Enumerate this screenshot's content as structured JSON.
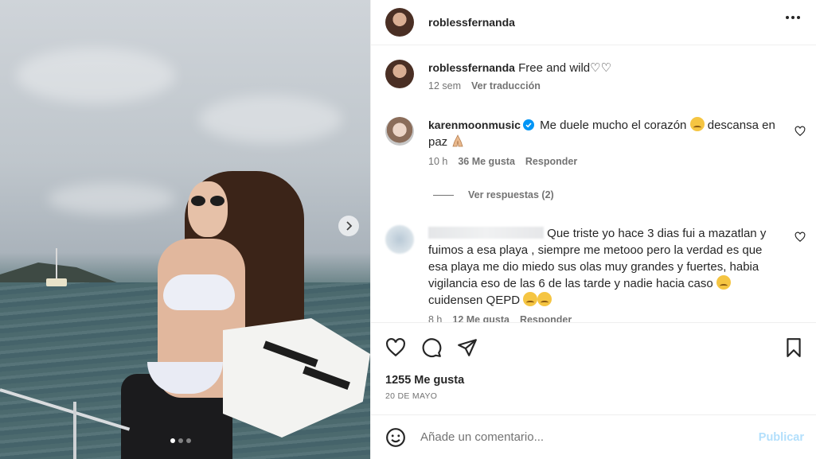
{
  "post": {
    "username": "roblessfernanda",
    "caption": "Free and wild♡♡",
    "caption_time": "12 sem",
    "translate_label": "Ver traducción",
    "likes": "1255 Me gusta",
    "date": "20 DE MAYO",
    "carousel": {
      "total": 3,
      "active": 1
    }
  },
  "comments": [
    {
      "username": "karenmoonmusic",
      "verified": true,
      "text_a": "Me duele mucho el corazón",
      "text_b": "descansa en paz",
      "time": "10 h",
      "likes": "36 Me gusta",
      "reply_label": "Responder",
      "view_replies": "Ver respuestas (2)"
    },
    {
      "username": "",
      "text_a": "Que triste yo hace 3 dias fui a mazatlan y fuimos a esa playa , siempre me metooo pero la verdad es que esa playa me dio miedo sus olas muy grandes y fuertes, habia vigilancia eso de las 6 de las tarde y nadie hacia caso",
      "text_b": "cuidensen QEPD",
      "time": "8 h",
      "likes": "12 Me gusta",
      "reply_label": "Responder"
    }
  ],
  "composer": {
    "placeholder": "Añade un comentario...",
    "publish_label": "Publicar"
  },
  "icons": [
    "more-icon",
    "heart-icon",
    "comment-icon",
    "share-icon",
    "bookmark-icon",
    "emoji-icon",
    "chevron-right-icon",
    "verified-icon"
  ]
}
